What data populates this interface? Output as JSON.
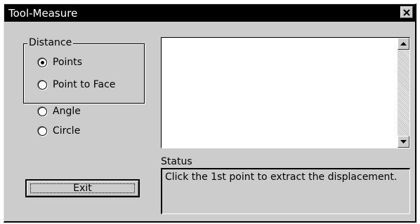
{
  "window": {
    "title": "Tool-Measure",
    "close_icon": "close-icon"
  },
  "distance_group": {
    "label": "Distance",
    "options": [
      {
        "label": "Points",
        "selected": true
      },
      {
        "label": "Point to Face",
        "selected": false
      }
    ]
  },
  "other_options": [
    {
      "label": "Angle",
      "selected": false
    },
    {
      "label": "Circle",
      "selected": false
    }
  ],
  "results_list": {
    "items": [],
    "scroll_up_icon": "scroll-up-arrow-icon",
    "scroll_down_icon": "scroll-down-arrow-icon"
  },
  "status": {
    "label": "Status",
    "message": "Click the 1st point to extract the displacement."
  },
  "exit_button": {
    "label": "Exit"
  }
}
